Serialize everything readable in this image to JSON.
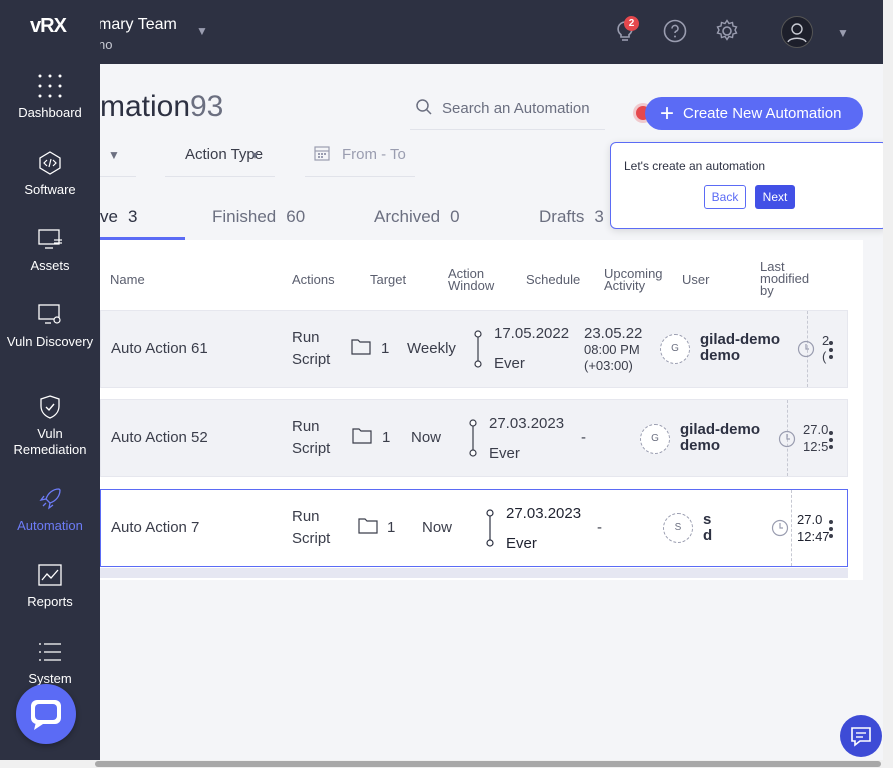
{
  "app": {
    "logo": "vRX"
  },
  "header": {
    "team_name": "mary Team",
    "team_sub": "no",
    "notification_count": "2"
  },
  "sidebar": {
    "items": [
      {
        "label": "Dashboard",
        "icon": "grid-dots-icon"
      },
      {
        "label": "Software",
        "icon": "code-icon"
      },
      {
        "label": "Assets",
        "icon": "monitor-stack-icon"
      },
      {
        "label": "Vuln Discovery",
        "icon": "monitor-search-icon"
      },
      {
        "label": "Vuln Remediation",
        "icon": "shield-check-icon"
      },
      {
        "label": "Automation",
        "icon": "rocket-icon",
        "active": true
      },
      {
        "label": "Reports",
        "icon": "chart-icon"
      },
      {
        "label": "System",
        "icon": "list-icon"
      }
    ]
  },
  "page": {
    "title": "mation",
    "count": "93",
    "search_placeholder": "Search an Automation",
    "create_button": "Create New Automation",
    "filters": {
      "action_type": "Action Type",
      "date_range": "From - To"
    }
  },
  "tabs": [
    {
      "label": "ve",
      "count": "3",
      "active": true
    },
    {
      "label": "Finished",
      "count": "60"
    },
    {
      "label": "Archived",
      "count": "0"
    },
    {
      "label": "Drafts",
      "count": "3"
    }
  ],
  "table": {
    "headers": {
      "name": "Name",
      "actions": "Actions",
      "target": "Target",
      "action_window_1": "Action",
      "action_window_2": "Window",
      "schedule": "Schedule",
      "upcoming_1": "Upcoming",
      "upcoming_2": "Activity",
      "user": "User",
      "last_modified_1": "Last",
      "last_modified_2": "modified",
      "last_modified_3": "by"
    },
    "rows": [
      {
        "name": "Auto Action 61",
        "action_1": "Run",
        "action_2": "Script",
        "target": "1",
        "schedule": "Weekly",
        "window_start": "17.05.2022",
        "window_end": "Ever",
        "upcoming_date": "23.05.22",
        "upcoming_time": "08:00 PM",
        "upcoming_tz": "(+03:00)",
        "user_initial": "G",
        "user_1": "gilad-demo",
        "user_2": "demo",
        "modified_1": "2",
        "modified_2": "("
      },
      {
        "name": "Auto Action 52",
        "action_1": "Run",
        "action_2": "Script",
        "target": "1",
        "schedule": "Now",
        "window_start": "27.03.2023",
        "window_end": "Ever",
        "upcoming": "-",
        "user_initial": "G",
        "user_1": "gilad-demo",
        "user_2": "demo",
        "modified_1": "27.0",
        "modified_2": "12:5"
      },
      {
        "name": "Auto Action 7",
        "action_1": "Run",
        "action_2": "Script",
        "target": "1",
        "schedule": "Now",
        "window_start": "27.03.2023",
        "window_end": "Ever",
        "upcoming": "-",
        "user_initial": "S",
        "user_1": "s",
        "user_2": "d",
        "modified_1": "27.0",
        "modified_2": "12:47"
      }
    ]
  },
  "popover": {
    "text": "Let's create an automation",
    "back": "Back",
    "next": "Next"
  },
  "colors": {
    "accent": "#5b6bf5",
    "sidebar": "#2d3142",
    "danger": "#e5484d"
  }
}
